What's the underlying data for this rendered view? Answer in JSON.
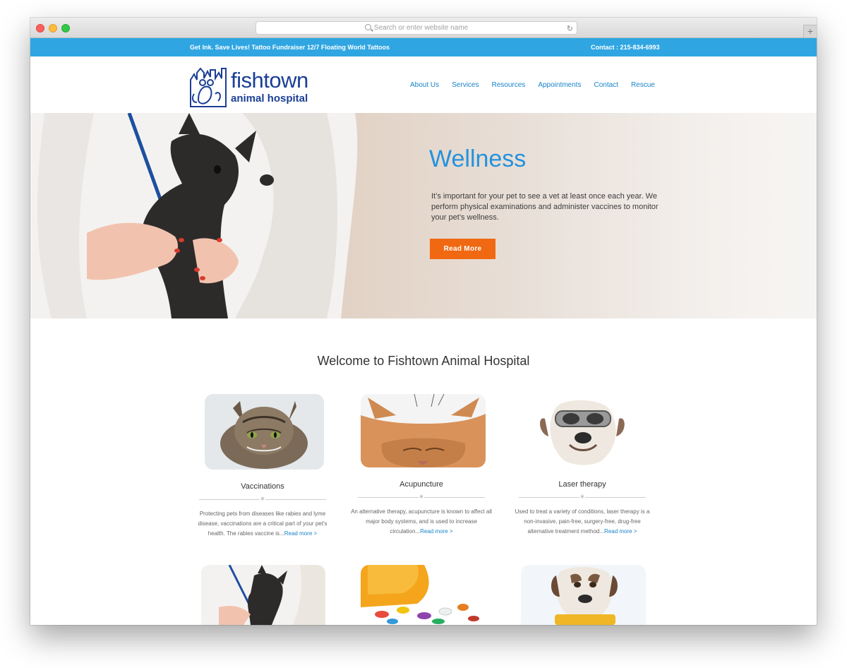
{
  "browser": {
    "url_placeholder": "Search or enter website name",
    "reload_glyph": "↻",
    "newtab_glyph": "+"
  },
  "topbar": {
    "promo": "Get Ink. Save Lives! Tattoo Fundraiser 12/7 Floating World Tattoos",
    "contact": "Contact : 215-834-6993"
  },
  "logo": {
    "line1": "fishtown",
    "line2": "animal hospital"
  },
  "nav": [
    "About Us",
    "Services",
    "Resources",
    "Appointments",
    "Contact",
    "Rescue"
  ],
  "hero": {
    "title": "Wellness",
    "text": "It’s important for your pet to see a vet at least once each year. We perform physical examinations and administer vaccines to monitor your pet’s wellness.",
    "button": "Read More"
  },
  "welcome": "Welcome to Fishtown Animal Hospital",
  "cards": [
    {
      "title": "Vaccinations",
      "desc": "Protecting pets from diseases like rabies and lyme disease, vaccinations are a critical part of your pet's health. The rabies vaccine is...",
      "more": "Read more >"
    },
    {
      "title": "Acupuncture",
      "desc": "An alternative therapy, acupuncture is known to affect all major body systems, and is used to increase circulation...",
      "more": "Read more >"
    },
    {
      "title": "Laser therapy",
      "desc": "Used to treat a variety of conditions, laser therapy is a non-invasive, pain-free, surgery-free, drug-free alternative treatment method...",
      "more": "Read more >"
    }
  ],
  "divider_glyph": "✳",
  "colors": {
    "topbar": "#2fa6e2",
    "brand": "#1b3f95",
    "link": "#1a83c9",
    "hero_title": "#2592dd",
    "button": "#f06811"
  }
}
